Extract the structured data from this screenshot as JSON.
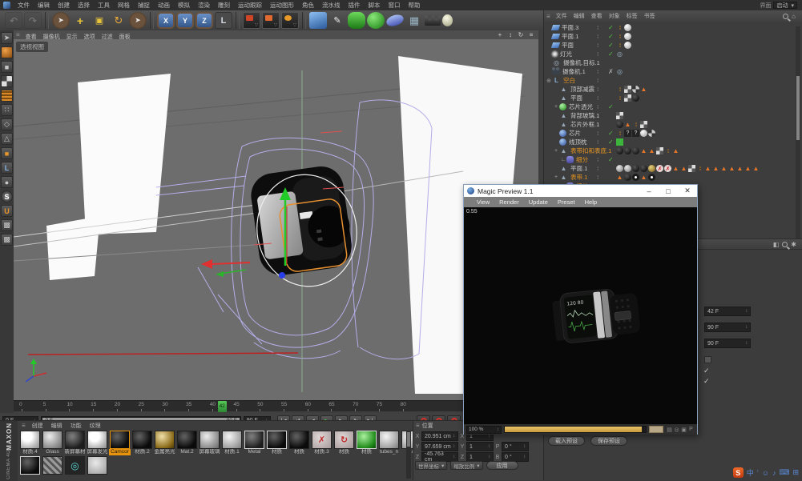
{
  "window": {
    "interface_label": "界面",
    "layout_value": "启动"
  },
  "menubar": {
    "items": [
      "文件",
      "编辑",
      "创建",
      "选择",
      "工具",
      "网格",
      "捕捉",
      "动画",
      "模拟",
      "渲染",
      "雕刻",
      "运动跟踪",
      "运动图形",
      "角色",
      "流水线",
      "插件",
      "脚本",
      "窗口",
      "帮助"
    ]
  },
  "toolbar": {
    "icons": [
      {
        "n": "undo-icon",
        "c": "i-dim",
        "t": "↶"
      },
      {
        "n": "redo-icon",
        "c": "i-dim",
        "t": "↷"
      },
      {
        "n": "separator",
        "c": "i-sep"
      },
      {
        "n": "live-selection-icon",
        "c": "i-ccl",
        "t": "➤"
      },
      {
        "n": "move-icon",
        "c": "i-move",
        "t": "+"
      },
      {
        "n": "scale-icon",
        "c": "i-scale",
        "t": "▣"
      },
      {
        "n": "rotate-icon",
        "c": "i-rot",
        "t": "↻"
      },
      {
        "n": "last-tool-icon",
        "c": "i-ccl",
        "t": "➤"
      },
      {
        "n": "separator",
        "c": "i-sep"
      },
      {
        "n": "lock-x-icon",
        "c": "i-xyz",
        "t": "X"
      },
      {
        "n": "lock-y-icon",
        "c": "i-xyz",
        "t": "Y"
      },
      {
        "n": "lock-z-icon",
        "c": "i-xyz",
        "t": "Z"
      },
      {
        "n": "coord-system-icon",
        "c": "i-coord",
        "t": "L"
      },
      {
        "n": "separator",
        "c": "i-sep"
      },
      {
        "n": "render-view-icon",
        "c": "i-clap"
      },
      {
        "n": "render-to-picture-icon",
        "c": "i-clap i-clap2"
      },
      {
        "n": "render-settings-icon",
        "c": "i-clap i-clap3"
      },
      {
        "n": "separator",
        "c": "i-sep"
      },
      {
        "n": "add-cube-icon",
        "c": "i-cube"
      },
      {
        "n": "pen-icon",
        "c": "i-pen",
        "t": "✎"
      },
      {
        "n": "subdivision-surface-icon",
        "c": "i-subd"
      },
      {
        "n": "cloner-icon",
        "c": "i-cloner"
      },
      {
        "n": "deformer-icon",
        "c": "i-deform"
      },
      {
        "n": "floor-icon",
        "c": "i-floor",
        "t": "▦"
      },
      {
        "n": "camera-icon",
        "c": "i-camtool"
      },
      {
        "n": "light-icon",
        "c": "i-lighttool"
      }
    ]
  },
  "left_toolbar": {
    "icons": [
      {
        "n": "make-editable-icon",
        "t": "➤"
      },
      {
        "n": "texture-ball-icon",
        "c": "l-orangeball"
      },
      {
        "n": "model-mode-icon",
        "t": "■"
      },
      {
        "n": "texture-mode-icon",
        "c": "l-checker"
      },
      {
        "n": "uv-grid-icon",
        "c": "l-grid"
      },
      {
        "n": "points-mode-icon",
        "t": "∷"
      },
      {
        "n": "edges-mode-icon",
        "t": "◇"
      },
      {
        "n": "polygons-mode-icon",
        "t": "△"
      },
      {
        "n": "object-axis-icon",
        "c": "l-orange",
        "t": "■"
      },
      {
        "n": "workplane-icon",
        "c": "l-blue",
        "t": "L"
      },
      {
        "n": "viewport-solo-icon",
        "t": "●"
      },
      {
        "n": "simulation-icon",
        "c": "l-scircle",
        "t": "S"
      },
      {
        "n": "snap-icon",
        "c": "l-snap",
        "t": "U"
      },
      {
        "n": "quantize-icon",
        "t": "▩"
      },
      {
        "n": "workplane-lock-icon",
        "t": "▩"
      }
    ]
  },
  "viewport": {
    "menu": [
      "查看",
      "摄像机",
      "显示",
      "选项",
      "过滤",
      "面板"
    ],
    "label": "透视视图",
    "nav_icons": [
      {
        "n": "pan-icon",
        "t": "+"
      },
      {
        "n": "dolly-icon",
        "t": "↕"
      },
      {
        "n": "orbit-icon",
        "t": "↻"
      },
      {
        "n": "toggle-view-icon",
        "t": "≡"
      }
    ]
  },
  "timeline": {
    "ticks": [
      0,
      5,
      10,
      15,
      20,
      25,
      30,
      35,
      40,
      45,
      50,
      55,
      60,
      65,
      70,
      75,
      80
    ],
    "current": 42,
    "current_label": "42",
    "start_field": "0 F",
    "range_start": "0 F",
    "range_end": "90 F",
    "end_field": "90 F",
    "play_buttons": [
      {
        "n": "goto-start-button",
        "t": "|◀"
      },
      {
        "n": "play-backward-button",
        "t": "↺"
      },
      {
        "n": "prev-frame-button",
        "t": "◀"
      },
      {
        "n": "play-button",
        "t": "▶",
        "g": 1
      },
      {
        "n": "next-frame-button",
        "t": "▶"
      },
      {
        "n": "play-forward-button",
        "t": "↻"
      },
      {
        "n": "goto-end-button",
        "t": "▶|"
      }
    ],
    "record_buttons": [
      {
        "n": "record-button"
      },
      {
        "n": "autokey-button"
      },
      {
        "n": "keyframe-selection-button"
      }
    ]
  },
  "materials": {
    "menu": [
      "创建",
      "编辑",
      "功能",
      "纹理"
    ],
    "brand_top": "MAXON",
    "brand_sub": "CINEMA 4D",
    "row1": [
      {
        "l": "材质.4",
        "c": "m-white"
      },
      {
        "l": "Glass",
        "c": "m-glass"
      },
      {
        "l": "新屏幕材",
        "c": "m-dark"
      },
      {
        "l": "屏幕发光",
        "c": "m-white"
      },
      {
        "l": "Camcor",
        "c": "m-black",
        "lsel": true
      },
      {
        "l": "材质.2",
        "c": "m-black"
      },
      {
        "l": "金属亮光",
        "c": "m-gold"
      },
      {
        "l": "Mat.2",
        "c": "m-black"
      },
      {
        "l": "屏幕玻璃",
        "c": "m-glass"
      },
      {
        "l": "材质.1",
        "c": "m-lgray"
      },
      {
        "l": "Metal",
        "c": "m-dark",
        "sel": true
      },
      {
        "l": "材质",
        "c": "m-black",
        "sel": true
      },
      {
        "l": "材质",
        "c": "m-black"
      },
      {
        "l": "材质.3",
        "c": "m-redx",
        "t": "✗"
      },
      {
        "l": "材质",
        "c": "m-redring",
        "t": "↻"
      },
      {
        "l": "材质",
        "c": "m-green",
        "sel": true
      },
      {
        "l": "tubes_n",
        "c": "m-lgray"
      },
      {
        "l": "Mat",
        "c": "m-lgray"
      }
    ],
    "row2": [
      {
        "l": "",
        "c": "m-black",
        "sel": true
      },
      {
        "l": "",
        "c": "m-stripe"
      },
      {
        "l": "",
        "c": "m-rings",
        "t": "◎"
      },
      {
        "l": "",
        "c": "m-face"
      }
    ]
  },
  "coords": {
    "title": "位置",
    "rows": [
      {
        "a": "X",
        "v": "20.951 cm",
        "sa": "X",
        "s": "1",
        "rl": "",
        "r": ""
      },
      {
        "a": "Y",
        "v": "97.659 cm",
        "sa": "Y",
        "s": "1",
        "rl": "P",
        "r": "0 °"
      },
      {
        "a": "Z",
        "v": "-45.763 cm",
        "sa": "Z",
        "s": "1",
        "rl": "B",
        "r": "0 °"
      }
    ],
    "dd1": "世界坐标",
    "dd2": "缩放比例",
    "apply": "应用"
  },
  "object_manager": {
    "menu": [
      "文件",
      "编辑",
      "查看",
      "对象",
      "标签",
      "书签"
    ],
    "tree": [
      {
        "e": "",
        "d": 0,
        "i": "plane",
        "n": "平面.3",
        "chk": "check",
        "tags": [
          "dots",
          "s-white"
        ]
      },
      {
        "e": "",
        "d": 0,
        "i": "plane",
        "n": "平面.1",
        "chk": "check",
        "tags": [
          "dots",
          "s-white"
        ]
      },
      {
        "e": "",
        "d": 0,
        "i": "plane",
        "n": "平面",
        "chk": "check",
        "tags": [
          "dots",
          "s-white"
        ]
      },
      {
        "e": "",
        "d": 0,
        "i": "light",
        "n": "灯光",
        "chk": "check",
        "tags": [
          "target"
        ]
      },
      {
        "e": "",
        "d": 0,
        "i": "camt",
        "n": "摄像机.目标.1",
        "chk": "",
        "tags": []
      },
      {
        "e": "",
        "d": 0,
        "i": "cam",
        "n": "摄像机.1",
        "chk": "x",
        "tags": [
          "target"
        ]
      },
      {
        "e": "o",
        "d": 0,
        "i": "null",
        "n": "空白",
        "sel": 1,
        "chk": "",
        "tags": []
      },
      {
        "e": "",
        "d": 1,
        "i": "poly",
        "n": "顶部减震",
        "chk": "",
        "tags": [
          "dots",
          "checker",
          "s-pattern",
          "tri"
        ]
      },
      {
        "e": "",
        "d": 1,
        "i": "poly",
        "n": "平面",
        "chk": "",
        "tags": [
          "dots",
          "checker",
          "s-black"
        ]
      },
      {
        "e": "+",
        "d": 1,
        "i": "sgreen",
        "n": "芯片透光",
        "chk": "check",
        "tags": []
      },
      {
        "e": "",
        "d": 1,
        "i": "poly",
        "n": "背部玻璃.1",
        "chk": "",
        "tags": [
          "checker"
        ]
      },
      {
        "e": "",
        "d": 1,
        "i": "poly",
        "n": "芯片外框.1",
        "chk": "",
        "tags": [
          "s-black",
          "tri",
          "dots",
          "checker"
        ]
      },
      {
        "e": "",
        "d": 1,
        "i": "sblue",
        "n": "芯片",
        "chk": "check",
        "tags": [
          "dots",
          "q",
          "q",
          "s-white",
          "s-pattern"
        ]
      },
      {
        "e": "",
        "d": 1,
        "i": "sblue",
        "n": "线顶枕",
        "chk": "check",
        "tags": [
          "g-sq"
        ]
      },
      {
        "e": "+",
        "d": 1,
        "i": "poly",
        "n": "表带扣和表底.1",
        "sel": 1,
        "chk": "",
        "tags": [
          "s-black",
          "s-black",
          "s-black",
          "tri",
          "tri",
          "checker",
          "dots",
          "tri"
        ]
      },
      {
        "e": "L",
        "d": 2,
        "i": "subd",
        "n": "细分",
        "sel": 1,
        "chk": "check",
        "tags": []
      },
      {
        "e": "",
        "d": 1,
        "i": "poly",
        "n": "平面.1",
        "chk": "",
        "tags": [
          "s-gray",
          "s-gray",
          "s-black",
          "s-black",
          "s-gold",
          "rx",
          "rx",
          "tri",
          "tri",
          "checker",
          "dots",
          "tri",
          "tri",
          "tri",
          "tri",
          "tri",
          "tri",
          "tri"
        ]
      },
      {
        "e": "+",
        "d": 1,
        "i": "poly",
        "n": "表带.1",
        "sel": 1,
        "chk": "",
        "tags": [
          "tri",
          "s-black",
          "s-dot",
          "tri",
          "s-dot"
        ]
      },
      {
        "e": "L",
        "d": 2,
        "i": "subd",
        "n": "细分",
        "sel": 1,
        "chk": "check",
        "tags": []
      }
    ],
    "toolbar_icons": [
      {
        "n": "mode-icon",
        "t": "◧"
      },
      {
        "n": "search-icon",
        "c": "om-search"
      },
      {
        "n": "gear-icon",
        "t": "✱"
      }
    ]
  },
  "attr_panel": {
    "f1": "42 F",
    "f2": "90 F",
    "f3": "90 F",
    "load_preset": "载入预设",
    "save_preset": "保存预设"
  },
  "magic_preview": {
    "title": "Magic Preview 1.1",
    "menu": [
      "View",
      "Render",
      "Update",
      "Preset",
      "Help"
    ],
    "time": "0.55",
    "zoom": "100 %",
    "watch": {
      "bp": "120 80"
    },
    "bottom_icons": [
      {
        "n": "alpha-icon",
        "t": "▤"
      },
      {
        "n": "compare-icon",
        "t": "◎"
      },
      {
        "n": "save-image-icon",
        "t": "▣"
      },
      {
        "n": "pin-icon",
        "t": "P"
      }
    ]
  },
  "taskbar": {
    "icons": [
      {
        "n": "sogou-logo-icon",
        "c": "sg-s",
        "t": "S"
      },
      {
        "n": "lang-zh-icon",
        "c": "sg-b",
        "t": "中"
      },
      {
        "n": "punctuation-icon",
        "c": "sg-b",
        "t": "’"
      },
      {
        "n": "emoji-icon",
        "c": "sg-b",
        "t": "☺"
      },
      {
        "n": "voice-icon",
        "c": "sg-b",
        "t": "♪"
      },
      {
        "n": "keyboard-icon",
        "c": "sg-b",
        "t": "⌨"
      },
      {
        "n": "toolbox-icon",
        "c": "sg-b",
        "t": "⊞"
      }
    ]
  }
}
